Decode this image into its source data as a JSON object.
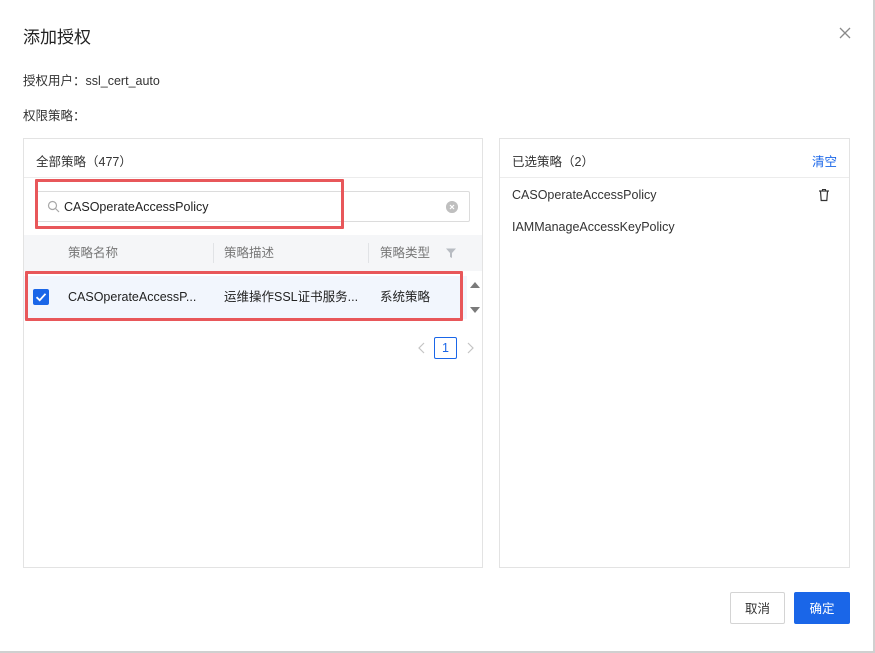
{
  "dialog": {
    "title": "添加授权",
    "user_line": "授权用户：ssl_cert_auto",
    "policy_label": "权限策略："
  },
  "left_panel": {
    "title": "全部策略（477）",
    "search": {
      "value": "CASOperateAccessPolicy",
      "placeholder": ""
    },
    "columns": [
      "策略名称",
      "策略描述",
      "策略类型"
    ],
    "rows": [
      {
        "name": "CASOperateAccessP...",
        "description": "运维操作SSL证书服务...",
        "type": "系统策略",
        "checked": true
      }
    ],
    "pagination": {
      "current_page": "1"
    }
  },
  "right_panel": {
    "title": "已选策略（2）",
    "clear_label": "清空",
    "items": [
      "CASOperateAccessPolicy",
      "IAMManageAccessKeyPolicy"
    ]
  },
  "footer": {
    "cancel_label": "取消",
    "ok_label": "确定"
  },
  "colors": {
    "primary": "#1a66e8",
    "highlight_frame": "#e8575a",
    "selected_row_bg": "#f2f6fd"
  },
  "icons": [
    "close-icon",
    "search-icon",
    "clear-icon",
    "filter-icon",
    "check-icon",
    "scroll-up-icon",
    "scroll-down-icon",
    "chevron-left-icon",
    "chevron-right-icon",
    "trash-icon"
  ]
}
